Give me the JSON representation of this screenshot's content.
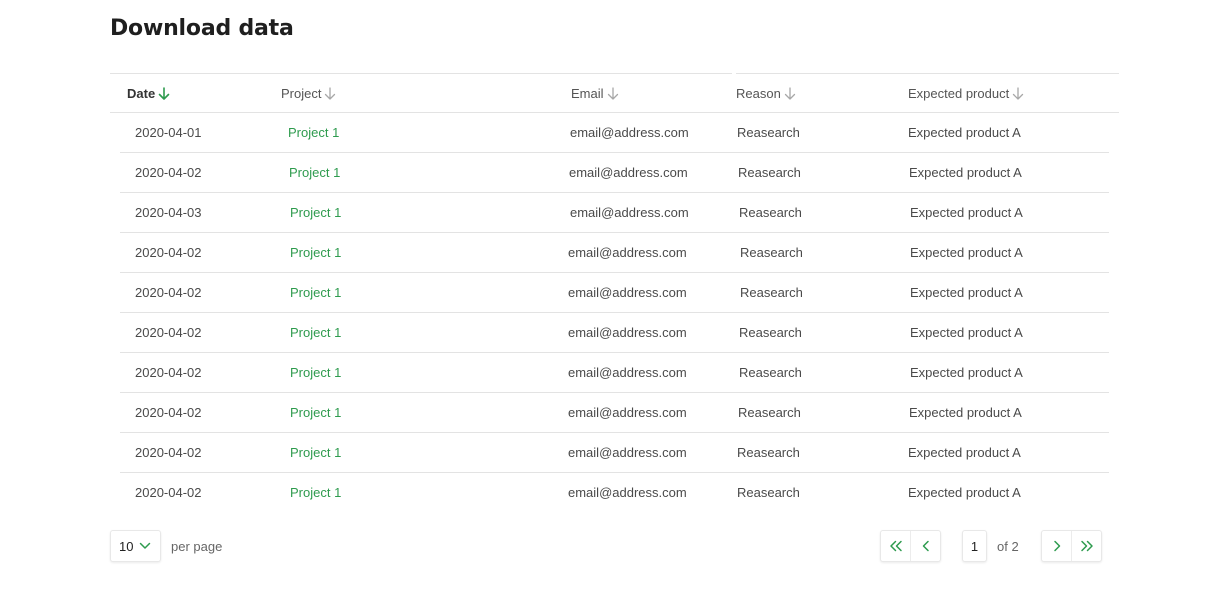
{
  "page": {
    "title": "Download data"
  },
  "colors": {
    "accent": "#2e9b4e",
    "text": "#4a4a4a",
    "border": "#e3e3e3"
  },
  "table": {
    "headers": [
      {
        "key": "date",
        "label": "Date",
        "active": true
      },
      {
        "key": "project",
        "label": "Project",
        "active": false
      },
      {
        "key": "email",
        "label": "Email",
        "active": false
      },
      {
        "key": "reason",
        "label": "Reason",
        "active": false
      },
      {
        "key": "product",
        "label": "Expected product",
        "active": false
      }
    ],
    "rows": [
      {
        "date": "2020-04-01",
        "project": "Project 1",
        "email": "email@address.com",
        "reason": "Reasearch",
        "product": "Expected product A"
      },
      {
        "date": "2020-04-02",
        "project": "Project 1",
        "email": "email@address.com",
        "reason": "Reasearch",
        "product": "Expected product A"
      },
      {
        "date": "2020-04-03",
        "project": "Project 1",
        "email": "email@address.com",
        "reason": "Reasearch",
        "product": "Expected product A"
      },
      {
        "date": "2020-04-02",
        "project": "Project 1",
        "email": "email@address.com",
        "reason": "Reasearch",
        "product": "Expected product A"
      },
      {
        "date": "2020-04-02",
        "project": "Project 1",
        "email": "email@address.com",
        "reason": "Reasearch",
        "product": "Expected product A"
      },
      {
        "date": "2020-04-02",
        "project": "Project 1",
        "email": "email@address.com",
        "reason": "Reasearch",
        "product": "Expected product A"
      },
      {
        "date": "2020-04-02",
        "project": "Project 1",
        "email": "email@address.com",
        "reason": "Reasearch",
        "product": "Expected product A"
      },
      {
        "date": "2020-04-02",
        "project": "Project 1",
        "email": "email@address.com",
        "reason": "Reasearch",
        "product": "Expected product A"
      },
      {
        "date": "2020-04-02",
        "project": "Project 1",
        "email": "email@address.com",
        "reason": "Reasearch",
        "product": "Expected product A"
      },
      {
        "date": "2020-04-02",
        "project": "Project 1",
        "email": "email@address.com",
        "reason": "Reasearch",
        "product": "Expected product A"
      }
    ]
  },
  "pagination": {
    "per_page_value": "10",
    "per_page_label": "per page",
    "current_page": "1",
    "of_label": "of 2",
    "icons": {
      "first": "double-chevron-left-icon",
      "prev": "chevron-left-icon",
      "next": "chevron-right-icon",
      "last": "double-chevron-right-icon",
      "select": "chevron-down-icon",
      "sort": "arrow-down-icon"
    }
  }
}
